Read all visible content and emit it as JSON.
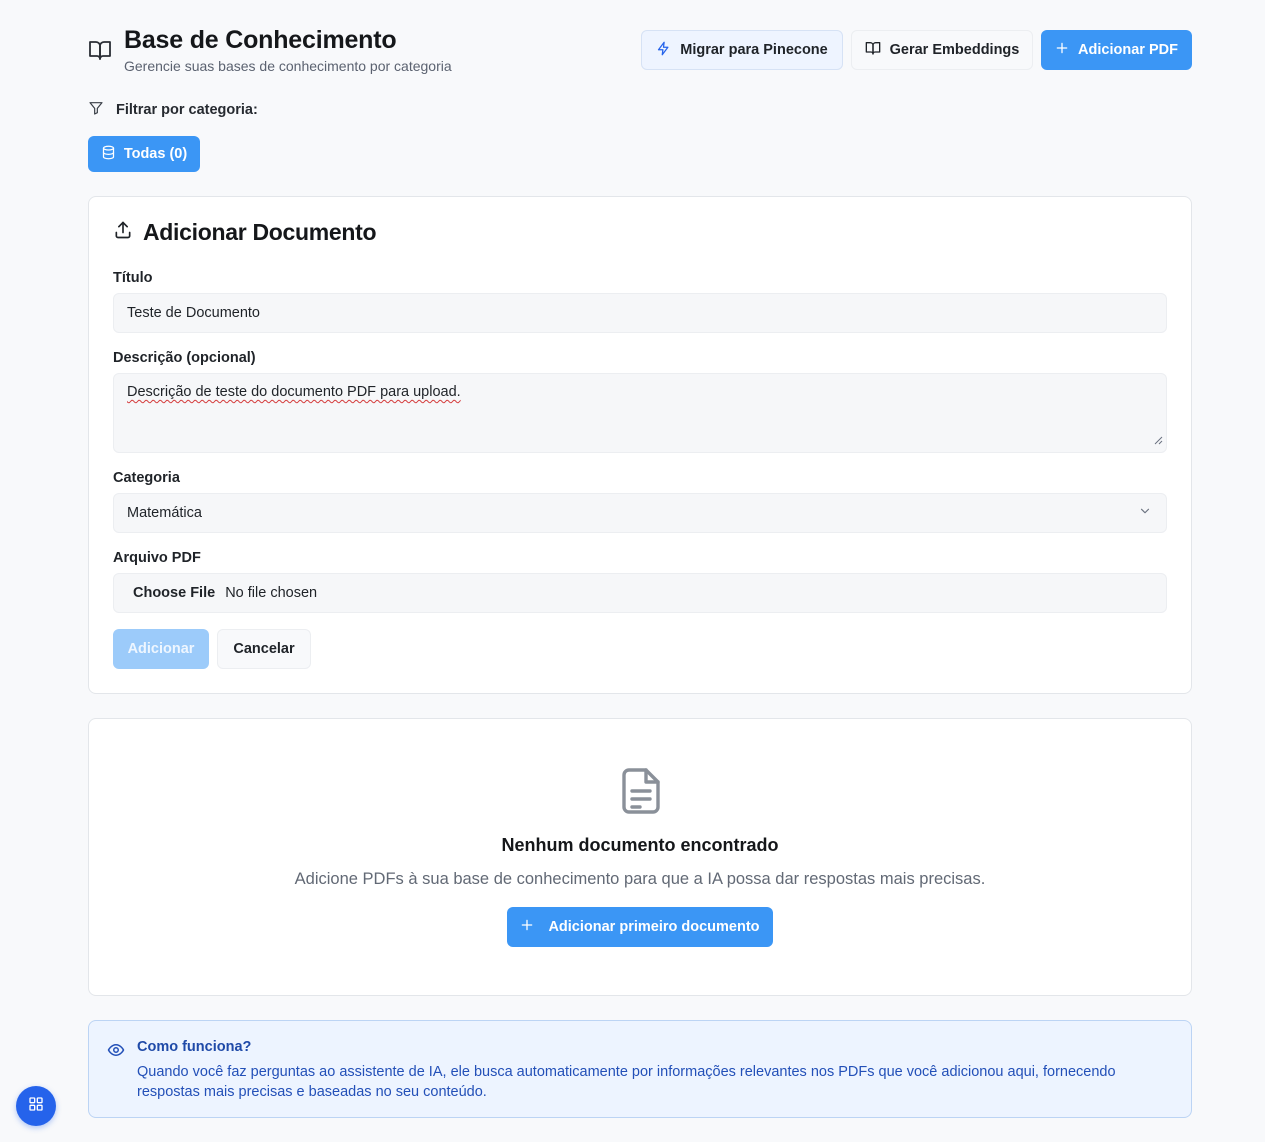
{
  "header": {
    "title": "Base de Conhecimento",
    "subtitle": "Gerencie suas bases de conhecimento por categoria",
    "migrate_label": "Migrar para Pinecone",
    "embeddings_label": "Gerar Embeddings",
    "add_pdf_label": "Adicionar PDF"
  },
  "filter": {
    "label": "Filtrar por categoria:",
    "chips": [
      {
        "label": "Todas (0)",
        "active": true
      }
    ]
  },
  "add_form": {
    "heading": "Adicionar Documento",
    "title_label": "Título",
    "title_value": "Teste de Documento",
    "description_label": "Descrição (opcional)",
    "description_value": "Descrição de teste do documento PDF para upload.",
    "category_label": "Categoria",
    "category_value": "Matemática",
    "file_label": "Arquivo PDF",
    "file_button": "Choose File",
    "file_status": "No file chosen",
    "submit_label": "Adicionar",
    "cancel_label": "Cancelar"
  },
  "empty_state": {
    "title": "Nenhum documento encontrado",
    "text": "Adicione PDFs à sua base de conhecimento para que a IA possa dar respostas mais precisas.",
    "button_label": "Adicionar primeiro documento"
  },
  "info": {
    "title": "Como funciona?",
    "text": "Quando você faz perguntas ao assistente de IA, ele busca automaticamente por informações relevantes nos PDFs que você adicionou aqui, fornecendo respostas mais precisas e baseadas no seu conteúdo."
  },
  "icons": {
    "title": "book-open-icon",
    "migrate": "lightning-icon",
    "embeddings": "book-open-icon",
    "add": "plus-icon",
    "filter": "filter-icon",
    "chip": "database-icon",
    "upload": "upload-icon",
    "select": "chevron-down-icon",
    "empty": "file-text-icon",
    "info": "eye-icon",
    "fab": "grid-icon"
  },
  "colors": {
    "primary": "#3b96f5",
    "primary_disabled": "#9ccbfa",
    "info_bg": "#edf4ff",
    "info_text": "#2350b8",
    "fab": "#2563eb"
  }
}
